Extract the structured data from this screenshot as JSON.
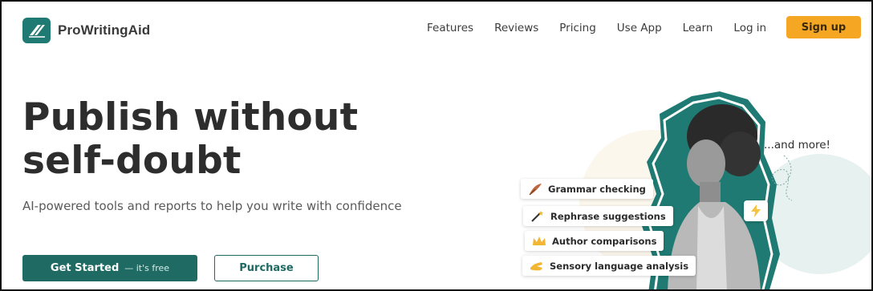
{
  "header": {
    "brand": "ProWritingAid",
    "nav": [
      {
        "label": "Features"
      },
      {
        "label": "Reviews"
      },
      {
        "label": "Pricing"
      },
      {
        "label": "Use App"
      },
      {
        "label": "Learn"
      },
      {
        "label": "Log in"
      }
    ],
    "signup_label": "Sign up"
  },
  "hero": {
    "title_line1": "Publish without",
    "title_line2": "self-doubt",
    "subtitle": "AI-powered tools and reports to help you write with confidence",
    "primary_button": "Get Started",
    "primary_button_suffix": "— it's free",
    "secondary_button": "Purchase"
  },
  "illustration": {
    "more_text": "...and more!",
    "features": [
      {
        "label": "Grammar checking",
        "icon": "quill-icon"
      },
      {
        "label": "Rephrase suggestions",
        "icon": "magic-wand-icon"
      },
      {
        "label": "Author comparisons",
        "icon": "crown-icon"
      },
      {
        "label": "Sensory language analysis",
        "icon": "pinching-hand-icon"
      }
    ],
    "badge_icon": "lightning-icon"
  },
  "colors": {
    "brand_teal": "#1f6b63",
    "accent_orange": "#f5a623"
  }
}
